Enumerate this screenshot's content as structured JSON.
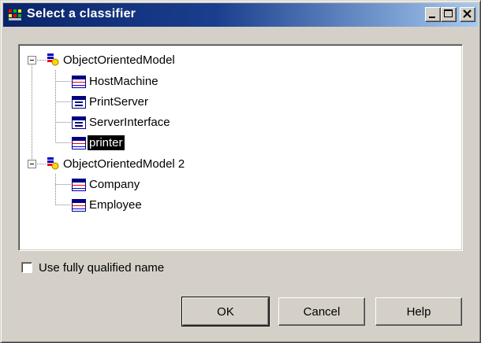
{
  "window": {
    "title": "Select a classifier",
    "icons": {
      "app": "classifier-app-icon",
      "minimize": "minimize-icon",
      "maximize": "maximize-icon",
      "close": "close-icon"
    }
  },
  "tree": {
    "models": [
      {
        "label": "ObjectOrientedModel",
        "icon": "model-package-icon",
        "expanded": true,
        "children": [
          {
            "label": "HostMachine",
            "icon": "class-icon"
          },
          {
            "label": "PrintServer",
            "icon": "interface-icon"
          },
          {
            "label": "ServerInterface",
            "icon": "interface-icon"
          },
          {
            "label": "printer",
            "icon": "class-icon",
            "selected": true
          }
        ]
      },
      {
        "label": "ObjectOrientedModel 2",
        "icon": "model-package-icon",
        "expanded": true,
        "children": [
          {
            "label": "Company",
            "icon": "class-icon"
          },
          {
            "label": "Employee",
            "icon": "class-icon"
          }
        ]
      }
    ]
  },
  "options": {
    "qualified_name_label": "Use fully qualified name",
    "qualified_name_checked": false
  },
  "buttons": {
    "ok": "OK",
    "cancel": "Cancel",
    "help": "Help"
  },
  "colors": {
    "title_gradient_start": "#0a246a",
    "title_gradient_end": "#a6caf0",
    "selection": "#000000",
    "face": "#d4d0c8"
  }
}
